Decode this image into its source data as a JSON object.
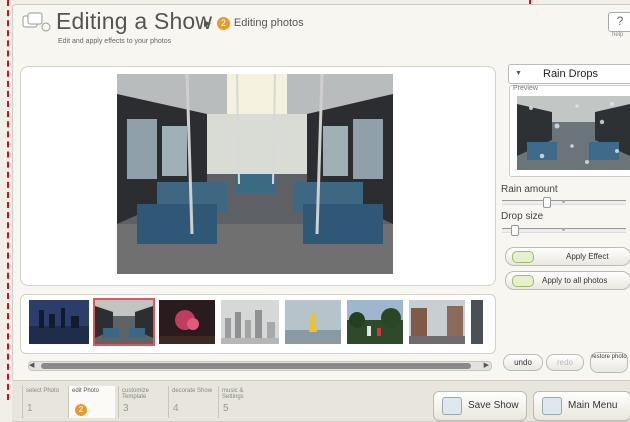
{
  "header": {
    "title": "Editing a Show",
    "step_number": "2",
    "step_label": "Editing photos",
    "subtitle": "Edit and apply effects to your photos",
    "help_label": "?",
    "help_caption": "help"
  },
  "effect_panel": {
    "selected_effect": "Rain Drops",
    "preview_label": "Preview",
    "controls": [
      {
        "label": "Rain amount",
        "value": 0.35
      },
      {
        "label": "Drop size",
        "value": 0.08
      }
    ],
    "apply_effect_label": "Apply Effect",
    "apply_all_label": "Apply to all photos"
  },
  "history": {
    "undo_label": "undo",
    "redo_label": "redo",
    "restore_label": "restore photo"
  },
  "steps": [
    {
      "name": "select Photo",
      "number": "1"
    },
    {
      "name": "edit Photo",
      "number": "2"
    },
    {
      "name": "customize Template",
      "number": "3"
    },
    {
      "name": "decorate Show",
      "number": "4"
    },
    {
      "name": "music & Settings",
      "number": "5"
    }
  ],
  "footer": {
    "save_label": "Save Show",
    "main_menu_label": "Main Menu"
  },
  "filmstrip": {
    "selected_index": 1,
    "thumbnail_count": 8
  },
  "colors": {
    "accent_orange": "#e99a2c",
    "selection_red": "#e0565b",
    "annotation_red": "#c8102e"
  }
}
